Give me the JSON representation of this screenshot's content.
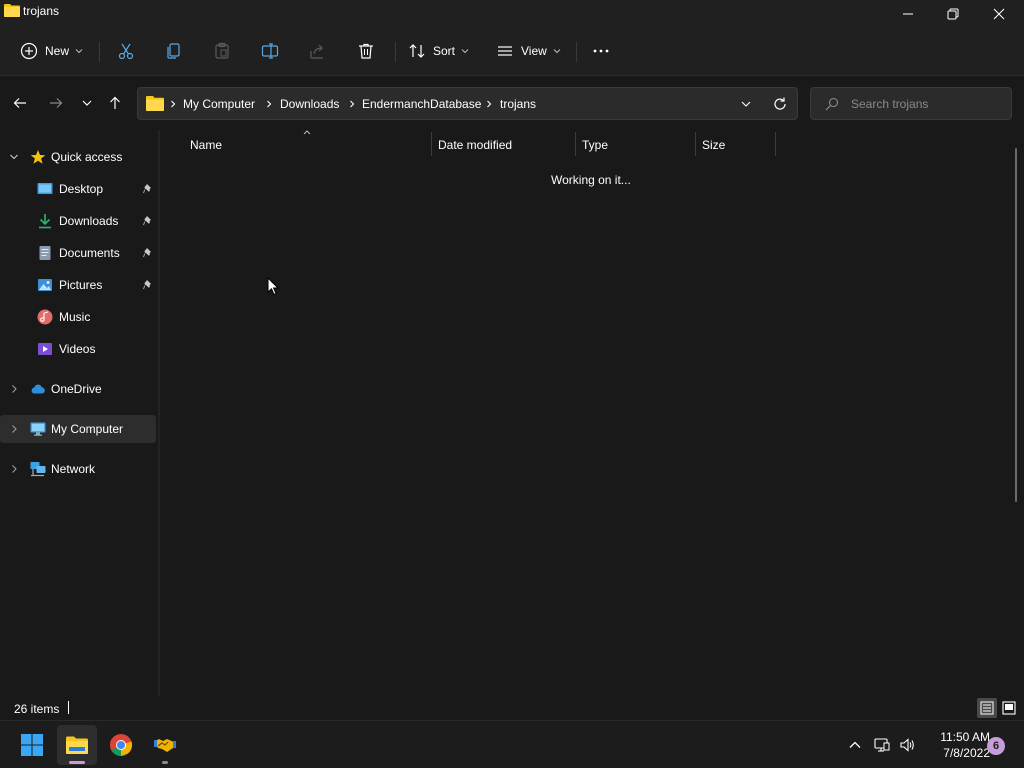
{
  "window": {
    "title": "trojans"
  },
  "window_controls": {
    "minimize_icon": "minimize-icon",
    "restore_icon": "restore-icon",
    "close_icon": "close-icon"
  },
  "command_bar": {
    "new_label": "New",
    "sort_label": "Sort",
    "view_label": "View",
    "icons": [
      "plus-circle-icon",
      "cut-icon",
      "copy-icon",
      "paste-icon",
      "rename-icon",
      "share-icon",
      "delete-icon",
      "sort-icon",
      "view-icon",
      "more-icon"
    ]
  },
  "address_bar": {
    "crumbs": [
      "My Computer",
      "Downloads",
      "EndermanchDatabase",
      "trojans"
    ]
  },
  "search": {
    "placeholder": "Search trojans"
  },
  "sidebar": {
    "items": [
      {
        "label": "Quick access",
        "icon": "star-icon"
      },
      {
        "label": "Desktop",
        "icon": "desktop-icon",
        "pinned": true
      },
      {
        "label": "Downloads",
        "icon": "download-icon",
        "pinned": true
      },
      {
        "label": "Documents",
        "icon": "document-icon",
        "pinned": true
      },
      {
        "label": "Pictures",
        "icon": "pictures-icon",
        "pinned": true
      },
      {
        "label": "Music",
        "icon": "music-icon"
      },
      {
        "label": "Videos",
        "icon": "videos-icon"
      },
      {
        "label": "OneDrive",
        "icon": "cloud-icon"
      },
      {
        "label": "My Computer",
        "icon": "computer-icon",
        "selected": true
      },
      {
        "label": "Network",
        "icon": "network-icon"
      }
    ]
  },
  "columns": {
    "name": "Name",
    "date_modified": "Date modified",
    "type": "Type",
    "size": "Size"
  },
  "content": {
    "status_message": "Working on it..."
  },
  "status_bar": {
    "item_count": "26 items"
  },
  "taskbar": {
    "apps": [
      "start-icon",
      "file-explorer-icon",
      "chrome-icon",
      "handshake-app-icon"
    ],
    "clock_time": "11:50 AM",
    "clock_date": "7/8/2022",
    "notification_count": "6",
    "accent_color": "#c69cd9"
  }
}
